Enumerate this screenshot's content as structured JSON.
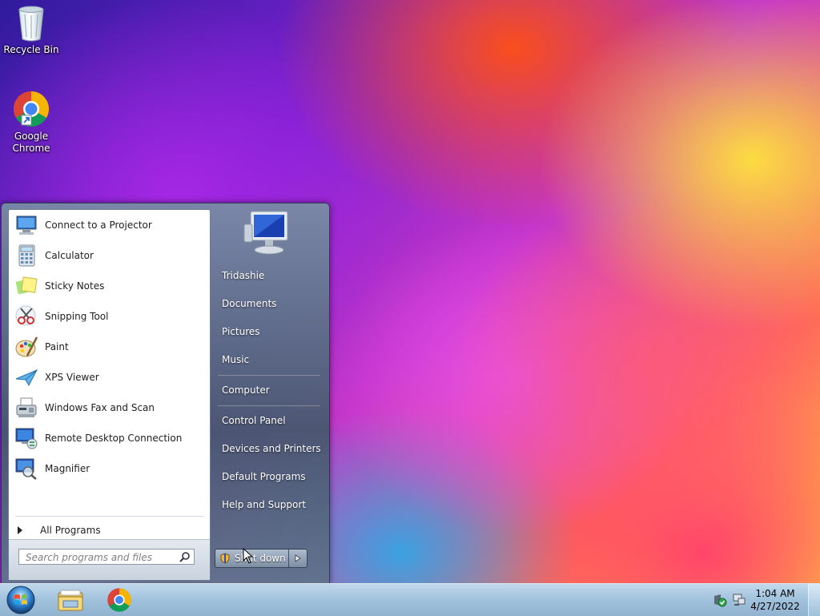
{
  "desktop": {
    "icons": [
      {
        "label": "Recycle Bin",
        "icon": "recycle-bin-icon"
      },
      {
        "label": "Google\nChrome",
        "label_line1": "Google",
        "label_line2": "Chrome",
        "icon": "chrome-icon"
      }
    ]
  },
  "start_menu": {
    "programs": [
      {
        "label": "Connect to a Projector",
        "icon": "projector-icon"
      },
      {
        "label": "Calculator",
        "icon": "calculator-icon"
      },
      {
        "label": "Sticky Notes",
        "icon": "sticky-notes-icon"
      },
      {
        "label": "Snipping Tool",
        "icon": "scissors-icon"
      },
      {
        "label": "Paint",
        "icon": "paint-palette-icon"
      },
      {
        "label": "XPS Viewer",
        "icon": "xps-viewer-icon"
      },
      {
        "label": "Windows Fax and Scan",
        "icon": "fax-icon"
      },
      {
        "label": "Remote Desktop Connection",
        "icon": "remote-desktop-icon"
      },
      {
        "label": "Magnifier",
        "icon": "magnifier-icon"
      }
    ],
    "all_programs": "All Programs",
    "search_placeholder": "Search programs and files",
    "right_items": [
      "Tridashie",
      "Documents",
      "Pictures",
      "Music",
      "Computer",
      "Control Panel",
      "Devices and Printers",
      "Default Programs",
      "Help and Support"
    ],
    "shutdown_label": "Shut down"
  },
  "taskbar": {
    "pinned": [
      "windows-explorer-icon",
      "chrome-icon"
    ],
    "clock": {
      "time": "1:04 AM",
      "date": "4/27/2022"
    }
  },
  "colors": {
    "taskbar": "#a9c6df",
    "start_menu_frame": "#5d7088",
    "left_pane": "#ffffff"
  }
}
